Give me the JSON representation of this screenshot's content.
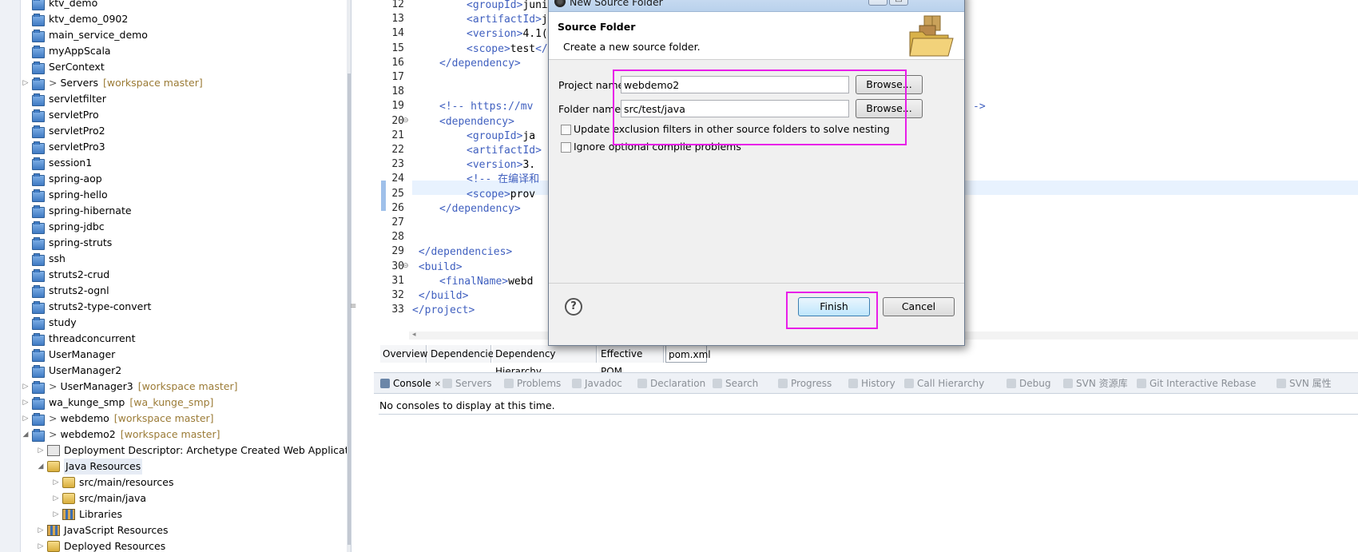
{
  "explorer": {
    "items": [
      {
        "label": "ktv_demo",
        "kind": "project"
      },
      {
        "label": "ktv_demo_0902",
        "kind": "project"
      },
      {
        "label": "main_service_demo",
        "kind": "project"
      },
      {
        "label": "myAppScala",
        "kind": "project"
      },
      {
        "label": "SerContext",
        "kind": "project"
      },
      {
        "label": "Servers",
        "kind": "repo-project",
        "prefix": ">",
        "decoration": "[workspace master]"
      },
      {
        "label": "servletfilter",
        "kind": "project"
      },
      {
        "label": "servletPro",
        "kind": "project"
      },
      {
        "label": "servletPro2",
        "kind": "project"
      },
      {
        "label": "servletPro3",
        "kind": "project"
      },
      {
        "label": "session1",
        "kind": "project"
      },
      {
        "label": "spring-aop",
        "kind": "project"
      },
      {
        "label": "spring-hello",
        "kind": "project"
      },
      {
        "label": "spring-hibernate",
        "kind": "project"
      },
      {
        "label": "spring-jdbc",
        "kind": "project"
      },
      {
        "label": "spring-struts",
        "kind": "project"
      },
      {
        "label": "ssh",
        "kind": "project"
      },
      {
        "label": "struts2-crud",
        "kind": "project"
      },
      {
        "label": "struts2-ognl",
        "kind": "project"
      },
      {
        "label": "struts2-type-convert",
        "kind": "project"
      },
      {
        "label": "study",
        "kind": "project"
      },
      {
        "label": "threadconcurrent",
        "kind": "project"
      },
      {
        "label": "UserManager",
        "kind": "project"
      },
      {
        "label": "UserManager2",
        "kind": "project"
      },
      {
        "label": "UserManager3",
        "kind": "repo-project",
        "prefix": ">",
        "decoration": "[workspace master]"
      },
      {
        "label": "wa_kunge_smp",
        "kind": "repo-project",
        "decoration": "[wa_kunge_smp]"
      },
      {
        "label": "webdemo",
        "kind": "repo-project",
        "prefix": ">",
        "decoration": "[workspace master]"
      },
      {
        "label": "webdemo2",
        "kind": "repo-project",
        "prefix": ">",
        "decoration": "[workspace master]",
        "expanded": true
      },
      {
        "label": "Deployment Descriptor: Archetype Created Web Application",
        "kind": "descriptor",
        "level": 1
      },
      {
        "label": "Java Resources",
        "kind": "package",
        "level": 1,
        "expanded": true,
        "selected": true
      },
      {
        "label": "src/main/resources",
        "kind": "package",
        "level": 2
      },
      {
        "label": "src/main/java",
        "kind": "package",
        "level": 2
      },
      {
        "label": "Libraries",
        "kind": "library",
        "level": 2
      },
      {
        "label": "JavaScript Resources",
        "kind": "library",
        "level": 1
      },
      {
        "label": "Deployed Resources",
        "kind": "package",
        "level": 1
      }
    ]
  },
  "editor": {
    "lines": [
      {
        "n": "12",
        "indent": 2,
        "parts": [
          [
            "tag",
            "<groupId>"
          ],
          [
            "txt",
            "juni"
          ]
        ]
      },
      {
        "n": "13",
        "indent": 2,
        "parts": [
          [
            "tag",
            "<artifactId>"
          ],
          [
            "txt",
            "j"
          ]
        ]
      },
      {
        "n": "14",
        "indent": 2,
        "parts": [
          [
            "tag",
            "<version>"
          ],
          [
            "txt",
            "4.1("
          ]
        ]
      },
      {
        "n": "15",
        "indent": 2,
        "parts": [
          [
            "tag",
            "<scope>"
          ],
          [
            "txt",
            "test"
          ],
          [
            "tag",
            "</"
          ]
        ]
      },
      {
        "n": "16",
        "indent": 1,
        "parts": [
          [
            "tag",
            "</dependency>"
          ]
        ]
      },
      {
        "n": "17",
        "indent": 0,
        "parts": []
      },
      {
        "n": "18",
        "indent": 0,
        "parts": []
      },
      {
        "n": "19",
        "indent": 1,
        "parts": [
          [
            "cmt",
            "<!-- https://mv"
          ]
        ],
        "tail": "->"
      },
      {
        "n": "20",
        "indent": 1,
        "fold": true,
        "parts": [
          [
            "tag",
            "<dependency>"
          ]
        ]
      },
      {
        "n": "21",
        "indent": 2,
        "parts": [
          [
            "tag",
            "<groupId>"
          ],
          [
            "txt",
            "ja"
          ]
        ]
      },
      {
        "n": "22",
        "indent": 2,
        "parts": [
          [
            "tag",
            "<artifactId>"
          ]
        ]
      },
      {
        "n": "23",
        "indent": 2,
        "parts": [
          [
            "tag",
            "<version>"
          ],
          [
            "txt",
            "3."
          ]
        ]
      },
      {
        "n": "24",
        "indent": 2,
        "parts": [
          [
            "cmt",
            "<!-- 在编译和"
          ]
        ]
      },
      {
        "n": "25",
        "indent": 2,
        "parts": [
          [
            "tag",
            "<scope>"
          ],
          [
            "txt",
            "prov"
          ]
        ]
      },
      {
        "n": "26",
        "indent": 1,
        "parts": [
          [
            "tag",
            "</dependency>"
          ]
        ]
      },
      {
        "n": "27",
        "indent": 0,
        "parts": []
      },
      {
        "n": "28",
        "indent": 0,
        "parts": []
      },
      {
        "n": "29",
        "indent": 0,
        "parts": [
          [
            "tag",
            " </dependencies>"
          ]
        ]
      },
      {
        "n": "30",
        "indent": 0,
        "fold": true,
        "parts": [
          [
            "tag",
            " <build>"
          ]
        ]
      },
      {
        "n": "31",
        "indent": 1,
        "parts": [
          [
            "tag",
            "<finalName>"
          ],
          [
            "txt",
            "webd"
          ]
        ]
      },
      {
        "n": "32",
        "indent": 0,
        "parts": [
          [
            "tag",
            " </build>"
          ]
        ]
      },
      {
        "n": "33",
        "indent": 0,
        "parts": [
          [
            "tag",
            "</project>"
          ]
        ]
      }
    ],
    "tabs": [
      "Overview",
      "Dependencies",
      "Dependency Hierarchy",
      "Effective POM",
      "pom.xml"
    ],
    "active_tab": "pom.xml"
  },
  "bottom": {
    "tabs": [
      {
        "label": "Console",
        "active": true,
        "icon": "console-icon"
      },
      {
        "label": "Servers",
        "icon": "servers-icon"
      },
      {
        "label": "Problems",
        "icon": "problems-icon"
      },
      {
        "label": "Javadoc",
        "icon": "javadoc-icon"
      },
      {
        "label": "Declaration",
        "icon": "declaration-icon"
      },
      {
        "label": "Search",
        "icon": "search-icon"
      },
      {
        "label": "Progress",
        "icon": "progress-icon"
      },
      {
        "label": "History",
        "icon": "history-icon"
      },
      {
        "label": "Call Hierarchy",
        "icon": "call-hierarchy-icon"
      },
      {
        "label": "Debug",
        "icon": "debug-icon"
      },
      {
        "label": "SVN 资源库",
        "icon": "svn-repo-icon"
      },
      {
        "label": "Git Interactive Rebase",
        "icon": "git-rebase-icon"
      },
      {
        "label": "SVN 属性",
        "icon": "svn-props-icon"
      }
    ],
    "console_message": "No consoles to display at this time."
  },
  "dialog": {
    "window_title": "New Source Folder",
    "header_title": "Source Folder",
    "header_description": "Create a new source folder.",
    "project_name_label": "Project name:",
    "project_name_value": "webdemo2",
    "folder_name_label": "Folder name:",
    "folder_name_value": "src/test/java",
    "browse_label": "Browse...",
    "checkbox_update_label": "Update exclusion filters in other source folders to solve nesting",
    "checkbox_update_checked": false,
    "checkbox_ignore_label": "Ignore optional compile problems",
    "checkbox_ignore_checked": false,
    "help_label": "?",
    "finish_label": "Finish",
    "cancel_label": "Cancel"
  },
  "colors": {
    "highlight": "#e81ee8",
    "xml_tag": "#3f5fbf",
    "decoration": "#9b7b36"
  }
}
